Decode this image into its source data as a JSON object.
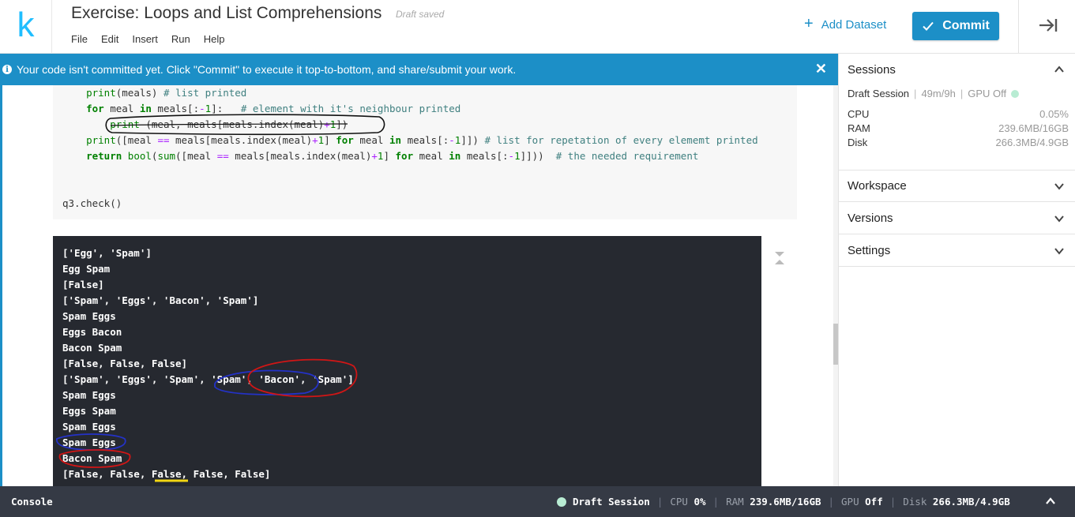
{
  "header": {
    "logo": "k",
    "title": "Exercise: Loops and List Comprehensions",
    "draft_status": "Draft saved",
    "menu": [
      "File",
      "Edit",
      "Insert",
      "Run",
      "Help"
    ],
    "add_dataset": "Add Dataset",
    "commit": "Commit"
  },
  "banner": {
    "message": "Your code isn't committed yet. Click \"Commit\" to execute it top-to-bottom, and share/submit your work."
  },
  "code_lines": [
    "    print(meals) # list printed",
    "    for meal in meals[:-1]:   # element with it's neighbour printed",
    "        print (meal, meals[meals.index(meal)+1])",
    "    print([meal == meals[meals.index(meal)+1] for meal in meals[:-1]]) # list for repetation of every elememt printed",
    "    return bool(sum([meal == meals[meals.index(meal)+1] for meal in meals[:-1]]))  # the needed requirement",
    "",
    "",
    "q3.check()"
  ],
  "output_lines": [
    "['Egg', 'Spam']",
    "Egg Spam",
    "[False]",
    "['Spam', 'Eggs', 'Bacon', 'Spam']",
    "Spam Eggs",
    "Eggs Bacon",
    "Bacon Spam",
    "[False, False, False]",
    "['Spam', 'Eggs', 'Spam', 'Spam', 'Bacon', 'Spam']",
    "Spam Eggs",
    "Eggs Spam",
    "Spam Eggs",
    "Spam Eggs",
    "Bacon Spam",
    "[False, False, False, False, False]"
  ],
  "sidebar": {
    "sessions": {
      "title": "Sessions",
      "session_name": "Draft Session",
      "time": "49m/9h",
      "gpu": "GPU Off",
      "resources": [
        {
          "label": "CPU",
          "value": "0.05%"
        },
        {
          "label": "RAM",
          "value": "239.6MB/16GB"
        },
        {
          "label": "Disk",
          "value": "266.3MB/4.9GB"
        }
      ]
    },
    "workspace": "Workspace",
    "versions": "Versions",
    "settings": "Settings"
  },
  "footer": {
    "console": "Console",
    "session": "Draft Session",
    "cpu_label": "CPU",
    "cpu_value": "0%",
    "ram_label": "RAM",
    "ram_value": "239.6MB/16GB",
    "gpu_label": "GPU",
    "gpu_value": "Off",
    "disk_label": "Disk",
    "disk_value": "266.3MB/4.9GB"
  },
  "colors": {
    "brand": "#20beff",
    "accent": "#1c8fc7",
    "output_bg": "#262930",
    "footer_bg": "#353a45",
    "session_dot": "#b8ecd3"
  }
}
